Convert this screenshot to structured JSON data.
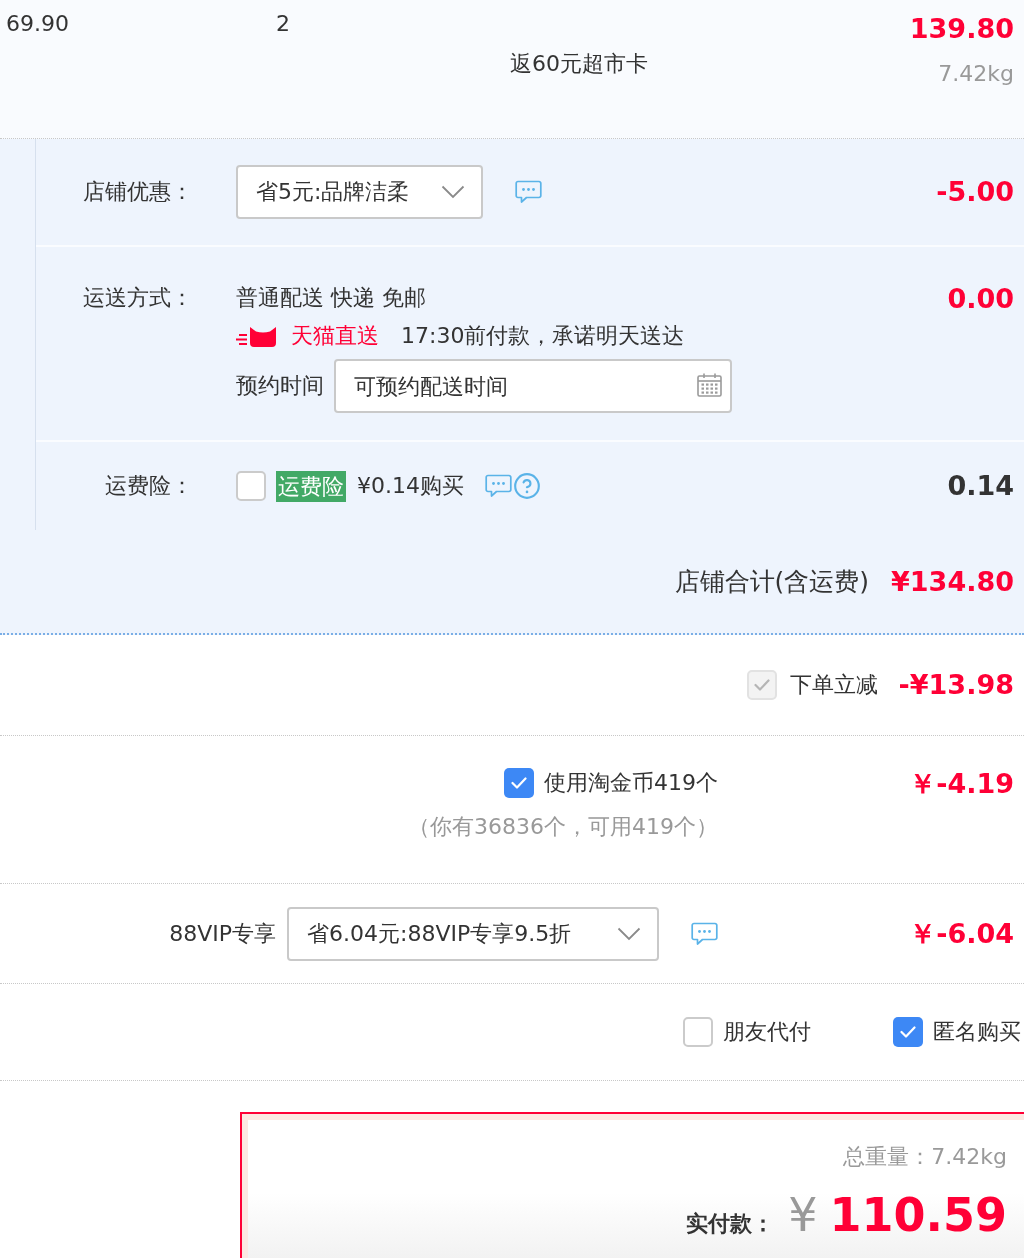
{
  "item": {
    "unit_price": "69.90",
    "quantity": "2",
    "promo": "返60元超市卡",
    "subtotal": "139.80",
    "weight": "7.42kg"
  },
  "store": {
    "discount": {
      "label": "店铺优惠：",
      "select": "省5元:品牌洁柔",
      "amount": "-5.00"
    },
    "shipping": {
      "label": "运送方式：",
      "method": "普通配送 快递 免邮",
      "badge": "天猫直送",
      "promise": "17:30前付款，承诺明天送达",
      "appointment_label": "预约时间",
      "appointment_field": {
        "placeholder": "可预约配送时间"
      },
      "amount": "0.00"
    },
    "insurance": {
      "label": "运费险：",
      "checked": false,
      "tag": "运费险",
      "price": "¥0.14购买",
      "amount": "0.14"
    },
    "total": {
      "label": "店铺合计(含运费)",
      "amount": "¥134.80"
    }
  },
  "order_discount": {
    "checked": true,
    "disabled": true,
    "label": "下单立减",
    "amount": "-¥13.98"
  },
  "coins": {
    "checked": true,
    "label": "使用淘金币419个",
    "note": "（你有36836个，可用419个）",
    "amount": "￥-4.19"
  },
  "vip": {
    "label": "88VIP专享",
    "select": "省6.04元:88VIP专享9.5折",
    "amount": "￥-6.04"
  },
  "options": [
    {
      "label": "朋友代付",
      "checked": false
    },
    {
      "label": "匿名购买",
      "checked": true
    }
  ],
  "summary": {
    "weight": "总重量：7.42kg",
    "pay_label": "实付款：",
    "currency": "¥",
    "total": "110.59"
  }
}
